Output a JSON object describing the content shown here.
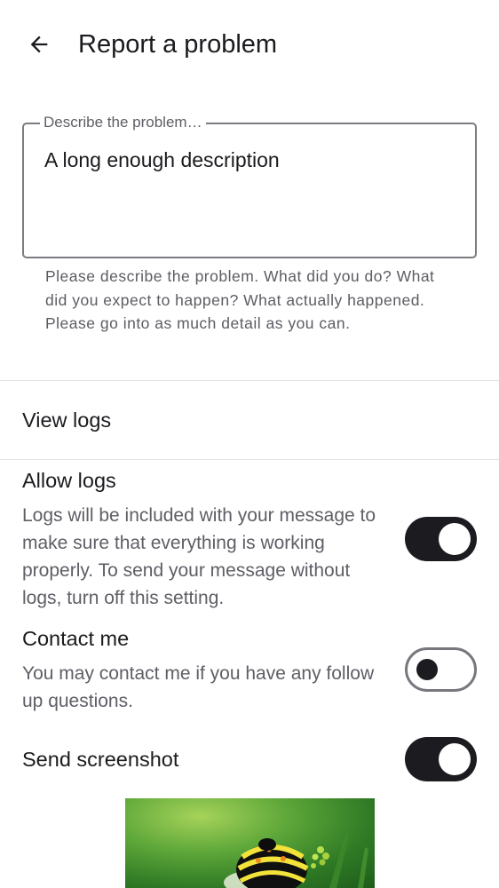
{
  "app_bar": {
    "back_icon": "arrow-back-icon",
    "title": "Report a problem"
  },
  "description_field": {
    "label": "Describe the problem…",
    "value": "A long enough description",
    "helper_text": "Please describe the problem. What did you do? What did you expect to happen? What actually happened. Please go into as much detail as you can."
  },
  "view_logs": {
    "label": "View logs"
  },
  "allow_logs": {
    "title": "Allow logs",
    "description": "Logs will be included with your message to make sure that everything is working properly. To send your message without logs, turn off this setting.",
    "enabled": true
  },
  "contact_me": {
    "title": "Contact me",
    "description": "You may contact me if you have any follow up questions.",
    "enabled": false
  },
  "send_screenshot": {
    "title": "Send screenshot",
    "enabled": true
  },
  "colors": {
    "switch_on": "#1c1c20",
    "switch_off_border": "#77777e",
    "divider": "#e2e2e6",
    "secondary_text": "#5e5e66"
  }
}
